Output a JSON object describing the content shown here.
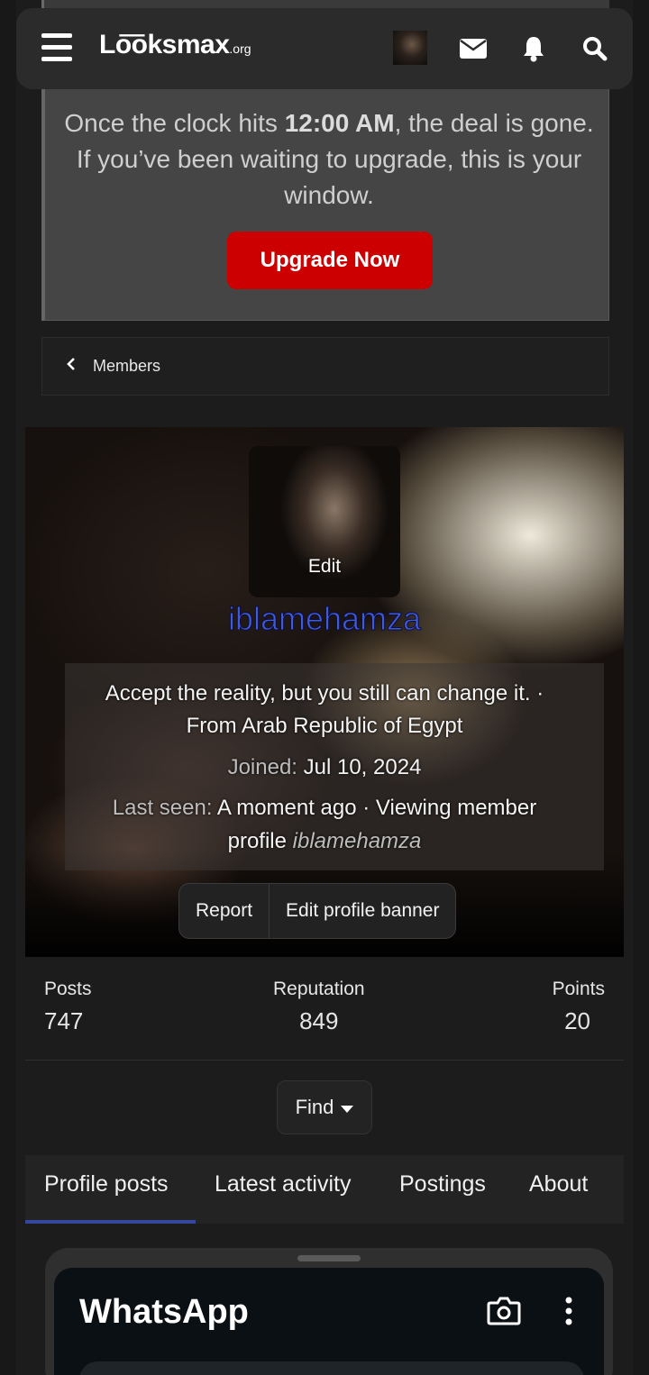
{
  "header": {
    "logo_main": "Lo͞oksmax",
    "logo_suffix": ".org",
    "icons": [
      "menu-icon",
      "avatar",
      "mail-icon",
      "bell-icon",
      "search-icon"
    ]
  },
  "notice": {
    "text_before": "Once the clock hits ",
    "text_bold": "12:00 AM",
    "text_after": ", the deal is gone. If you’ve been waiting to upgrade, this is your window.",
    "button": "Upgrade Now",
    "button_color": "#cc0000"
  },
  "breadcrumb": {
    "label": "Members"
  },
  "profile": {
    "avatar_edit": "Edit",
    "username": "iblamehamza",
    "username_color": "#3f5bd6",
    "tagline": "Accept the reality, but you still can change it. ·",
    "location": "From Arab Republic of Egypt",
    "joined_label": "Joined:",
    "joined_value": "Jul 10, 2024",
    "last_seen_label": "Last seen:",
    "last_seen_value": "A moment ago · Viewing member",
    "last_seen_value2": "profile",
    "last_seen_user": "iblamehamza",
    "report": "Report",
    "edit_banner": "Edit profile banner"
  },
  "stats": {
    "posts_label": "Posts",
    "posts": "747",
    "reputation_label": "Reputation",
    "reputation": "849",
    "points_label": "Points",
    "points": "20"
  },
  "find": {
    "label": "Find"
  },
  "tabs": [
    {
      "label": "Profile posts"
    },
    {
      "label": "Latest activity"
    },
    {
      "label": "Postings"
    },
    {
      "label": "About"
    }
  ],
  "embed": {
    "title": "WhatsApp"
  }
}
